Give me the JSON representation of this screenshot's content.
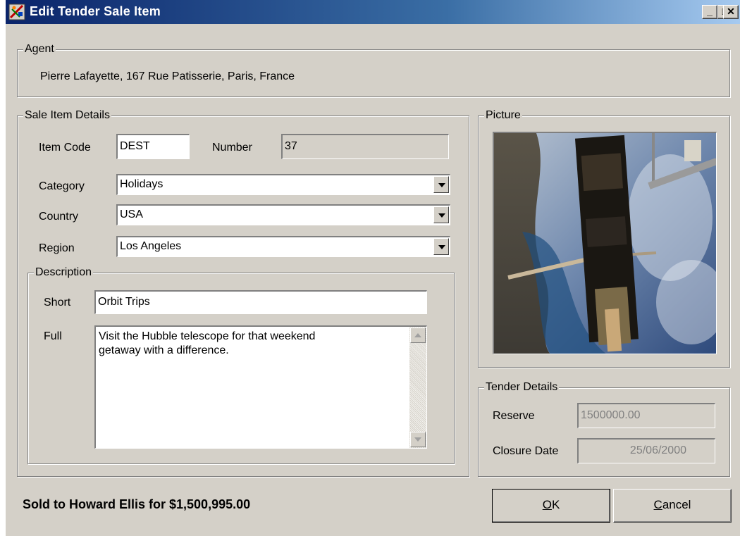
{
  "window": {
    "title": "Edit Tender Sale Item",
    "icon": "app-icon",
    "controls": {
      "minimize": "_",
      "maximize": "□",
      "close": "✕"
    }
  },
  "agent": {
    "legend": "Agent",
    "value": "Pierre Lafayette, 167 Rue Patisserie, Paris, France"
  },
  "sale_item": {
    "legend": "Sale Item Details",
    "item_code_label": "Item Code",
    "item_code_value": "DEST",
    "number_label": "Number",
    "number_value": "37",
    "category_label": "Category",
    "category_value": "Holidays",
    "country_label": "Country",
    "country_value": "USA",
    "region_label": "Region",
    "region_value": "Los Angeles"
  },
  "description": {
    "legend": "Description",
    "short_label": "Short",
    "short_value": "Orbit Trips",
    "full_label": "Full",
    "full_value": "Visit the Hubble telescope for that weekend\ngetaway with a difference."
  },
  "picture": {
    "legend": "Picture",
    "subject": "hubble-telescope-photo"
  },
  "tender": {
    "legend": "Tender Details",
    "reserve_label": "Reserve",
    "reserve_value": "1500000.00",
    "closure_label": "Closure Date",
    "closure_value": "25/06/2000"
  },
  "status_text": "Sold to Howard Ellis for $1,500,995.00",
  "buttons": {
    "ok_mnemonic": "O",
    "ok_rest": "K",
    "cancel_mnemonic": "C",
    "cancel_rest": "ancel"
  },
  "colors": {
    "face": "#d4d0c8",
    "title_start": "#0a246a",
    "title_end": "#a6caf0"
  }
}
